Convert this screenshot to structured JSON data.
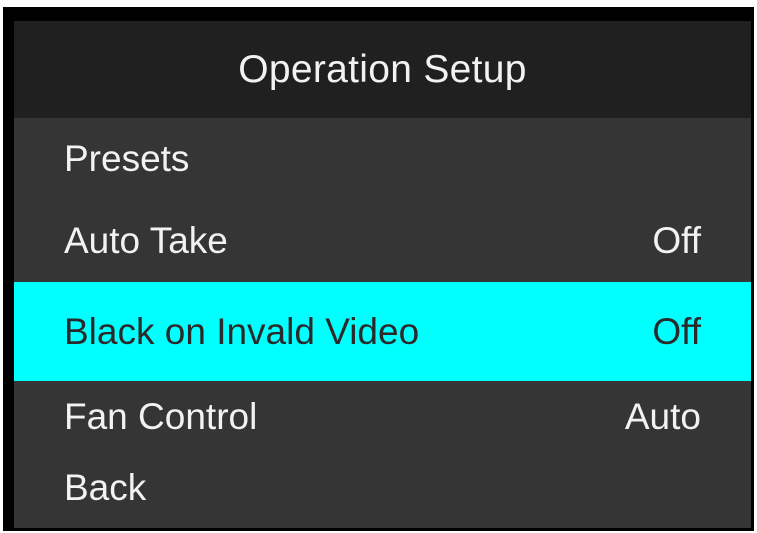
{
  "menu": {
    "title": "Operation Setup",
    "items": [
      {
        "label": "Presets",
        "value": ""
      },
      {
        "label": "Auto Take",
        "value": "Off"
      },
      {
        "label": "Black on Invald Video",
        "value": "Off",
        "selected": true
      },
      {
        "label": "Fan Control",
        "value": "Auto"
      },
      {
        "label": "Back",
        "value": ""
      }
    ]
  },
  "colors": {
    "header_bg": "#202020",
    "panel_bg": "#353535",
    "selection_bg": "#00ffff",
    "text": "#f2f2f2",
    "selected_text": "#2a2a2a"
  }
}
